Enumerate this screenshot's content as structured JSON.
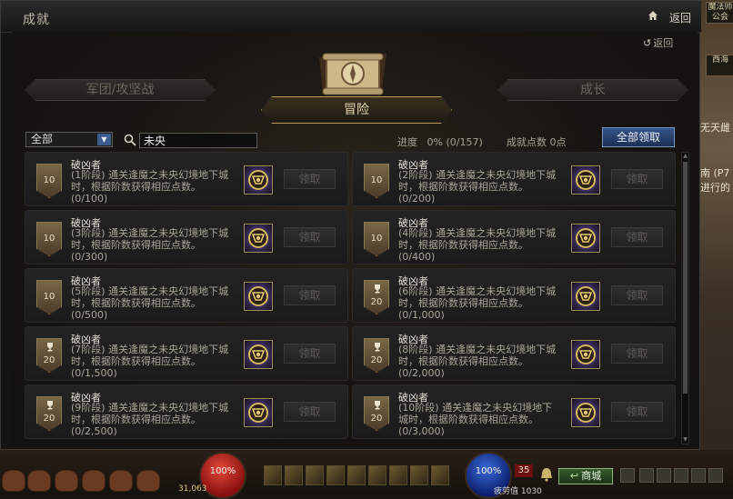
{
  "window": {
    "title": "成就",
    "return_label": "返回",
    "inner_back_label": "返回"
  },
  "tabs": {
    "legion": "军团/攻坚战",
    "adventure": "冒险",
    "growth": "成长"
  },
  "filter": {
    "selected": "全部",
    "search_value": "未央"
  },
  "summary": {
    "progress_label": "进度",
    "progress_value": "0% (0/157)",
    "points_label": "成就点数",
    "points_value": "0点",
    "claim_all_label": "全部领取"
  },
  "achievements": [
    {
      "title": "破凶者",
      "stage": "(1阶段)",
      "desc": "通关逢魔之未央幻境地下城时，根据阶数获得相应点数。",
      "progress": "(0/100)",
      "points": "10",
      "trophy": false,
      "claim_label": "领取"
    },
    {
      "title": "破凶者",
      "stage": "(2阶段)",
      "desc": "通关逢魔之未央幻境地下城时，根据阶数获得相应点数。",
      "progress": "(0/200)",
      "points": "10",
      "trophy": false,
      "claim_label": "领取"
    },
    {
      "title": "破凶者",
      "stage": "(3阶段)",
      "desc": "通关逢魔之未央幻境地下城时，根据阶数获得相应点数。",
      "progress": "(0/300)",
      "points": "10",
      "trophy": false,
      "claim_label": "领取"
    },
    {
      "title": "破凶者",
      "stage": "(4阶段)",
      "desc": "通关逢魔之未央幻境地下城时，根据阶数获得相应点数。",
      "progress": "(0/400)",
      "points": "10",
      "trophy": false,
      "claim_label": "领取"
    },
    {
      "title": "破凶者",
      "stage": "(5阶段)",
      "desc": "通关逢魔之未央幻境地下城时，根据阶数获得相应点数。",
      "progress": "(0/500)",
      "points": "10",
      "trophy": false,
      "claim_label": "领取"
    },
    {
      "title": "破凶者",
      "stage": "(6阶段)",
      "desc": "通关逢魔之未央幻境地下城时，根据阶数获得相应点数。",
      "progress": "(0/1,000)",
      "points": "20",
      "trophy": true,
      "claim_label": "领取"
    },
    {
      "title": "破凶者",
      "stage": "(7阶段)",
      "desc": "通关逢魔之未央幻境地下城时，根据阶数获得相应点数。",
      "progress": "(0/1,500)",
      "points": "20",
      "trophy": true,
      "claim_label": "领取"
    },
    {
      "title": "破凶者",
      "stage": "(8阶段)",
      "desc": "通关逢魔之未央幻境地下城时，根据阶数获得相应点数。",
      "progress": "(0/2,000)",
      "points": "20",
      "trophy": true,
      "claim_label": "领取"
    },
    {
      "title": "破凶者",
      "stage": "(9阶段)",
      "desc": "通关逢魔之未央幻境地下城时，根据阶数获得相应点数。",
      "progress": "(0/2,500)",
      "points": "20",
      "trophy": true,
      "claim_label": "领取"
    },
    {
      "title": "破凶者",
      "stage": "(10阶段)",
      "desc": "通关逢魔之未央幻境地下城时，根据阶数获得相应点数。",
      "progress": "(0/3,000)",
      "points": "20",
      "trophy": true,
      "claim_label": "领取"
    }
  ],
  "hud": {
    "hp_percent": "100%",
    "mp_percent": "100%",
    "level": "35",
    "town_label": "商城",
    "gold": "31,063",
    "fatigue": "疲劳值 1030"
  },
  "world": {
    "sign_top": "魔法师公会",
    "sign_mid": "西海",
    "note_1": "无天雌",
    "note_2": "南 (P7",
    "note_3": "进行的"
  },
  "icons": {
    "home": "home-icon",
    "back": "back-arrow-icon",
    "search": "search-icon",
    "dropdown": "chevron-down-icon",
    "emblem": "scroll-compass-emblem-icon",
    "trophy": "trophy-icon",
    "reward": "reward-medal-icon"
  }
}
